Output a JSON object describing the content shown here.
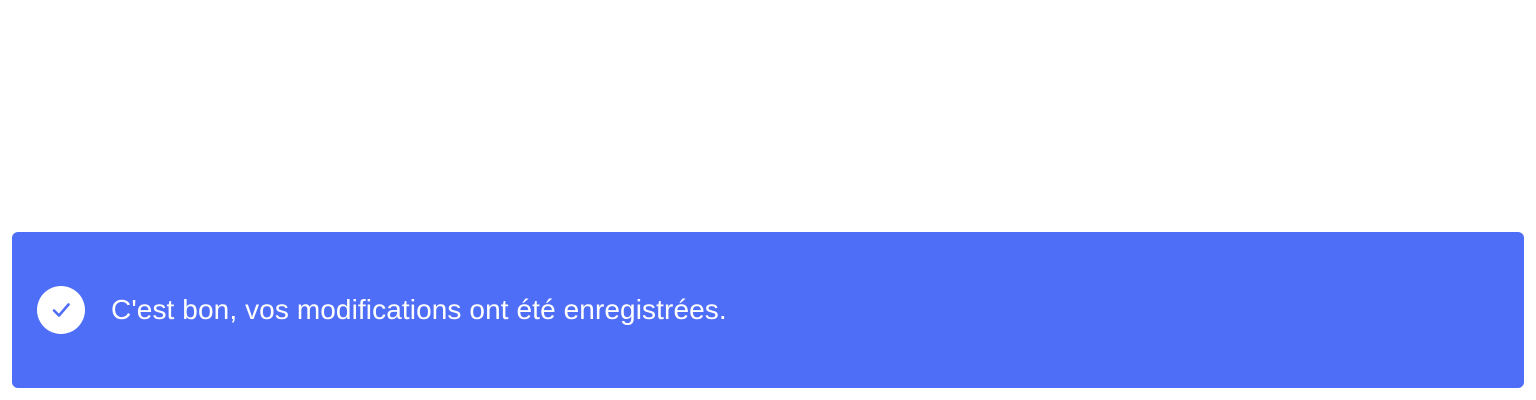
{
  "toast": {
    "message": "C'est bon, vos modifications ont été enregistrées.",
    "icon": "check-circle-icon",
    "background_color": "#4f6ef7",
    "icon_background_color": "#ffffff",
    "check_color": "#4f6ef7",
    "text_color": "#ffffff"
  }
}
